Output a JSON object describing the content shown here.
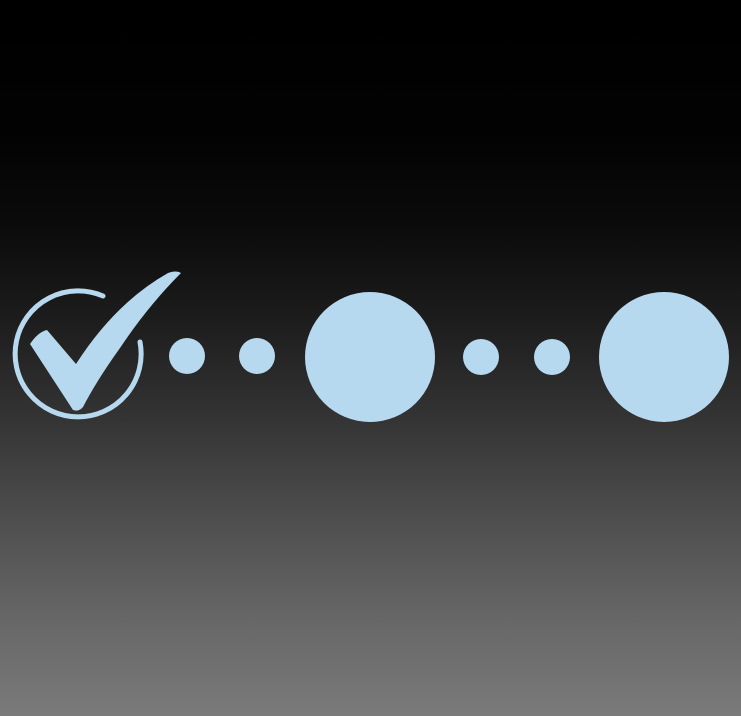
{
  "colors": {
    "accent": "#b7d9ef",
    "background_top": "#000000",
    "background_bottom": "#7a7a7a"
  },
  "steps": [
    {
      "state": "completed",
      "icon": "check-circle-icon"
    },
    {
      "state": "pending",
      "icon": "circle-icon"
    },
    {
      "state": "pending",
      "icon": "circle-icon"
    }
  ],
  "connectors": [
    {
      "icon": "dot-icon",
      "count": 2
    },
    {
      "icon": "dot-icon",
      "count": 2
    }
  ],
  "progress": {
    "completed_steps": 1,
    "total_steps": 3
  }
}
